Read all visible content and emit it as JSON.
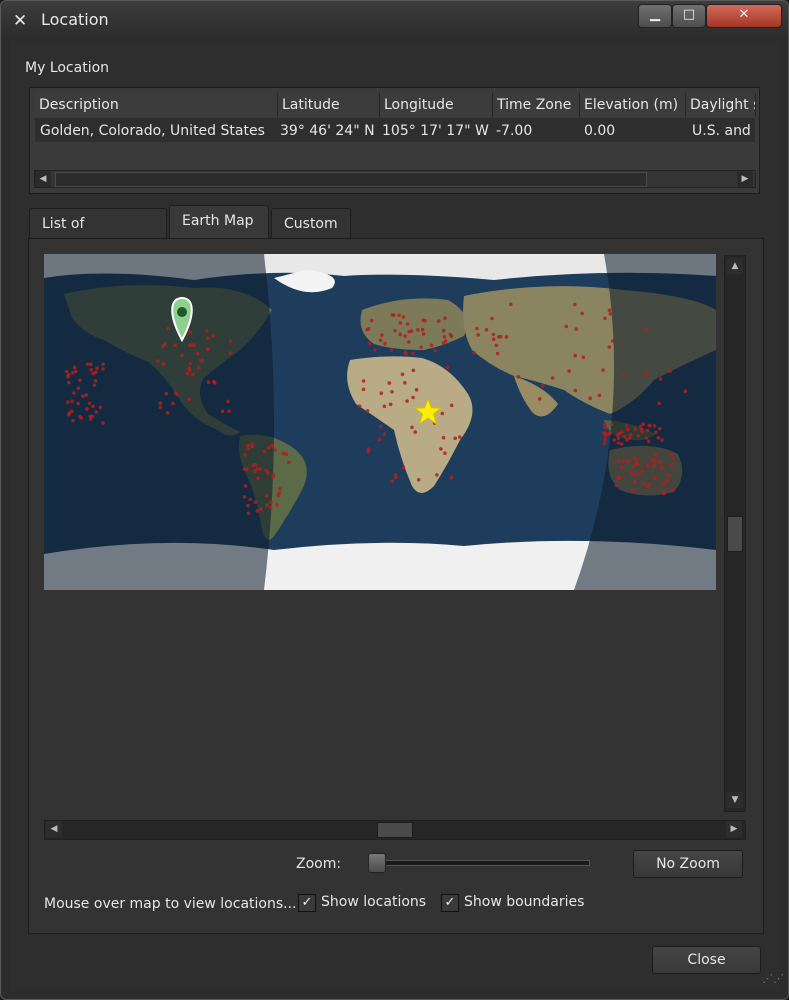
{
  "window": {
    "title": "Location",
    "minimize": "▁",
    "maximize": "□",
    "close": "✕"
  },
  "my_location": {
    "label": "My Location",
    "columns": [
      "Description",
      "Latitude",
      "Longitude",
      "Time Zone",
      "Elevation (m)",
      "Daylight s"
    ],
    "row": [
      "Golden, Colorado, United States",
      "39° 46' 24\" N",
      "105° 17' 17\" W",
      "-7.00",
      "0.00",
      "U.S. and"
    ]
  },
  "tabs": [
    {
      "label": "List of Locations",
      "active": false
    },
    {
      "label": "Earth Map",
      "active": true
    },
    {
      "label": "Custom",
      "active": false
    }
  ],
  "map": {
    "ocean_color": "#1e3d5c",
    "marker_color": "#8fcf8f",
    "sun_color": "#ffee00",
    "dot_color": "#b21e1e"
  },
  "zoom": {
    "label": "Zoom:",
    "value": 0,
    "button": "No Zoom"
  },
  "footer": {
    "hint": "Mouse over map to view locations...",
    "show_locations": {
      "label": "Show locations",
      "checked": true
    },
    "show_boundaries": {
      "label": "Show boundaries",
      "checked": true
    },
    "close": "Close"
  },
  "icons": {
    "app": "app-logo-icon",
    "marker": "map-pin-icon",
    "sun": "sun-star-icon",
    "scroll_up": "arrow-up-icon",
    "scroll_down": "arrow-down-icon",
    "scroll_left": "arrow-left-icon",
    "scroll_right": "arrow-right-icon"
  }
}
